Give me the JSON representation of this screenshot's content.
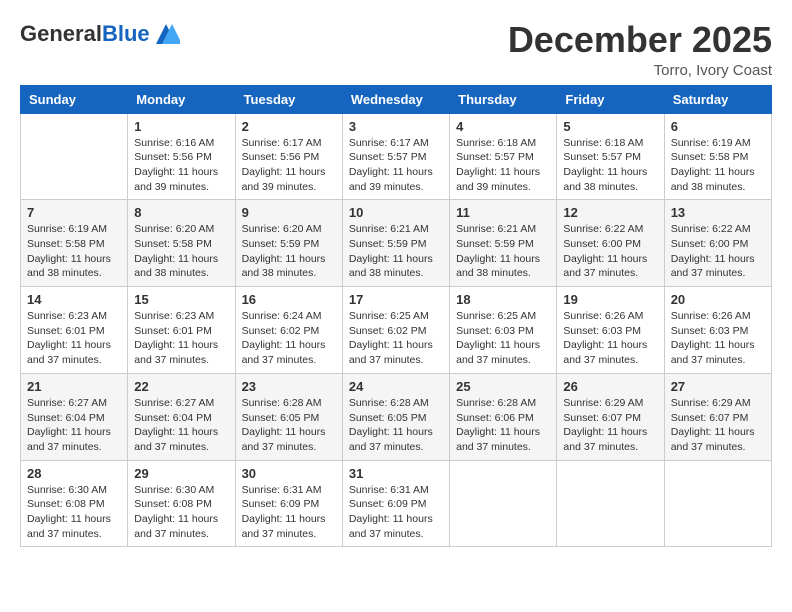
{
  "logo": {
    "general": "General",
    "blue": "Blue"
  },
  "header": {
    "month_title": "December 2025",
    "location": "Torro, Ivory Coast"
  },
  "days_of_week": [
    "Sunday",
    "Monday",
    "Tuesday",
    "Wednesday",
    "Thursday",
    "Friday",
    "Saturday"
  ],
  "weeks": [
    [
      {
        "day": "",
        "info": ""
      },
      {
        "day": "1",
        "info": "Sunrise: 6:16 AM\nSunset: 5:56 PM\nDaylight: 11 hours and 39 minutes."
      },
      {
        "day": "2",
        "info": "Sunrise: 6:17 AM\nSunset: 5:56 PM\nDaylight: 11 hours and 39 minutes."
      },
      {
        "day": "3",
        "info": "Sunrise: 6:17 AM\nSunset: 5:57 PM\nDaylight: 11 hours and 39 minutes."
      },
      {
        "day": "4",
        "info": "Sunrise: 6:18 AM\nSunset: 5:57 PM\nDaylight: 11 hours and 39 minutes."
      },
      {
        "day": "5",
        "info": "Sunrise: 6:18 AM\nSunset: 5:57 PM\nDaylight: 11 hours and 38 minutes."
      },
      {
        "day": "6",
        "info": "Sunrise: 6:19 AM\nSunset: 5:58 PM\nDaylight: 11 hours and 38 minutes."
      }
    ],
    [
      {
        "day": "7",
        "info": "Sunrise: 6:19 AM\nSunset: 5:58 PM\nDaylight: 11 hours and 38 minutes."
      },
      {
        "day": "8",
        "info": "Sunrise: 6:20 AM\nSunset: 5:58 PM\nDaylight: 11 hours and 38 minutes."
      },
      {
        "day": "9",
        "info": "Sunrise: 6:20 AM\nSunset: 5:59 PM\nDaylight: 11 hours and 38 minutes."
      },
      {
        "day": "10",
        "info": "Sunrise: 6:21 AM\nSunset: 5:59 PM\nDaylight: 11 hours and 38 minutes."
      },
      {
        "day": "11",
        "info": "Sunrise: 6:21 AM\nSunset: 5:59 PM\nDaylight: 11 hours and 38 minutes."
      },
      {
        "day": "12",
        "info": "Sunrise: 6:22 AM\nSunset: 6:00 PM\nDaylight: 11 hours and 37 minutes."
      },
      {
        "day": "13",
        "info": "Sunrise: 6:22 AM\nSunset: 6:00 PM\nDaylight: 11 hours and 37 minutes."
      }
    ],
    [
      {
        "day": "14",
        "info": "Sunrise: 6:23 AM\nSunset: 6:01 PM\nDaylight: 11 hours and 37 minutes."
      },
      {
        "day": "15",
        "info": "Sunrise: 6:23 AM\nSunset: 6:01 PM\nDaylight: 11 hours and 37 minutes."
      },
      {
        "day": "16",
        "info": "Sunrise: 6:24 AM\nSunset: 6:02 PM\nDaylight: 11 hours and 37 minutes."
      },
      {
        "day": "17",
        "info": "Sunrise: 6:25 AM\nSunset: 6:02 PM\nDaylight: 11 hours and 37 minutes."
      },
      {
        "day": "18",
        "info": "Sunrise: 6:25 AM\nSunset: 6:03 PM\nDaylight: 11 hours and 37 minutes."
      },
      {
        "day": "19",
        "info": "Sunrise: 6:26 AM\nSunset: 6:03 PM\nDaylight: 11 hours and 37 minutes."
      },
      {
        "day": "20",
        "info": "Sunrise: 6:26 AM\nSunset: 6:03 PM\nDaylight: 11 hours and 37 minutes."
      }
    ],
    [
      {
        "day": "21",
        "info": "Sunrise: 6:27 AM\nSunset: 6:04 PM\nDaylight: 11 hours and 37 minutes."
      },
      {
        "day": "22",
        "info": "Sunrise: 6:27 AM\nSunset: 6:04 PM\nDaylight: 11 hours and 37 minutes."
      },
      {
        "day": "23",
        "info": "Sunrise: 6:28 AM\nSunset: 6:05 PM\nDaylight: 11 hours and 37 minutes."
      },
      {
        "day": "24",
        "info": "Sunrise: 6:28 AM\nSunset: 6:05 PM\nDaylight: 11 hours and 37 minutes."
      },
      {
        "day": "25",
        "info": "Sunrise: 6:28 AM\nSunset: 6:06 PM\nDaylight: 11 hours and 37 minutes."
      },
      {
        "day": "26",
        "info": "Sunrise: 6:29 AM\nSunset: 6:07 PM\nDaylight: 11 hours and 37 minutes."
      },
      {
        "day": "27",
        "info": "Sunrise: 6:29 AM\nSunset: 6:07 PM\nDaylight: 11 hours and 37 minutes."
      }
    ],
    [
      {
        "day": "28",
        "info": "Sunrise: 6:30 AM\nSunset: 6:08 PM\nDaylight: 11 hours and 37 minutes."
      },
      {
        "day": "29",
        "info": "Sunrise: 6:30 AM\nSunset: 6:08 PM\nDaylight: 11 hours and 37 minutes."
      },
      {
        "day": "30",
        "info": "Sunrise: 6:31 AM\nSunset: 6:09 PM\nDaylight: 11 hours and 37 minutes."
      },
      {
        "day": "31",
        "info": "Sunrise: 6:31 AM\nSunset: 6:09 PM\nDaylight: 11 hours and 37 minutes."
      },
      {
        "day": "",
        "info": ""
      },
      {
        "day": "",
        "info": ""
      },
      {
        "day": "",
        "info": ""
      }
    ]
  ]
}
